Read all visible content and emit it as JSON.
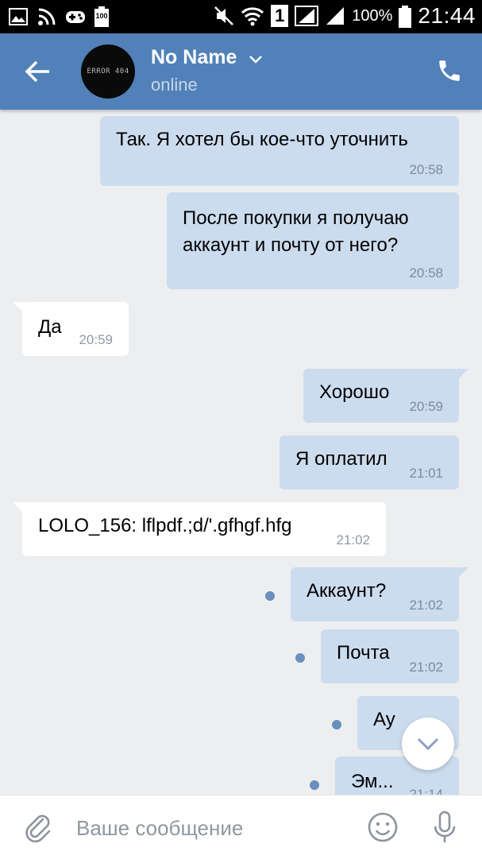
{
  "status_bar": {
    "signal_badge": "1",
    "battery_badge": "100",
    "battery_percent": "100%",
    "time": "21:44"
  },
  "header": {
    "contact_name": "No Name",
    "status": "online",
    "avatar_text": "ERROR 404"
  },
  "messages": [
    {
      "dir": "out",
      "text": "Так. Я хотел бы кое-что уточнить",
      "time": "20:58"
    },
    {
      "dir": "out",
      "text": "После покупки я получаю\nаккаунт и почту от него?",
      "time": "20:58"
    },
    {
      "dir": "in",
      "text": "Да",
      "time": "20:59"
    },
    {
      "dir": "out",
      "text": "Хорошо",
      "time": "20:59"
    },
    {
      "dir": "out",
      "text": "Я оплатил",
      "time": "21:01"
    },
    {
      "dir": "in",
      "text": "LOLO_156: lflpdf.;d/'.gfhgf.hfg",
      "time": "21:02"
    },
    {
      "dir": "out",
      "text": "Аккаунт?",
      "time": "21:02",
      "unread": true
    },
    {
      "dir": "out",
      "text": "Почта",
      "time": "21:02",
      "unread": true
    },
    {
      "dir": "out",
      "text": "Ау",
      "time": "",
      "unread": true
    },
    {
      "dir": "out",
      "text": "Эм...",
      "time": "21:14",
      "unread": true
    }
  ],
  "input": {
    "placeholder": "Ваше сообщение"
  },
  "colors": {
    "header": "#5181b8",
    "outgoing_bubble": "#ccdcef",
    "incoming_bubble": "#ffffff",
    "background": "#edeef0",
    "unread_dot": "#6a8fbe"
  },
  "icons": [
    "image-icon",
    "rss-icon",
    "gamepad-icon",
    "battery-saver-icon",
    "mute-icon",
    "wifi-icon",
    "signal-icon",
    "battery-icon",
    "back-arrow-icon",
    "chevron-down-icon",
    "phone-icon",
    "paperclip-icon",
    "emoji-icon",
    "microphone-icon",
    "scroll-down-icon"
  ]
}
